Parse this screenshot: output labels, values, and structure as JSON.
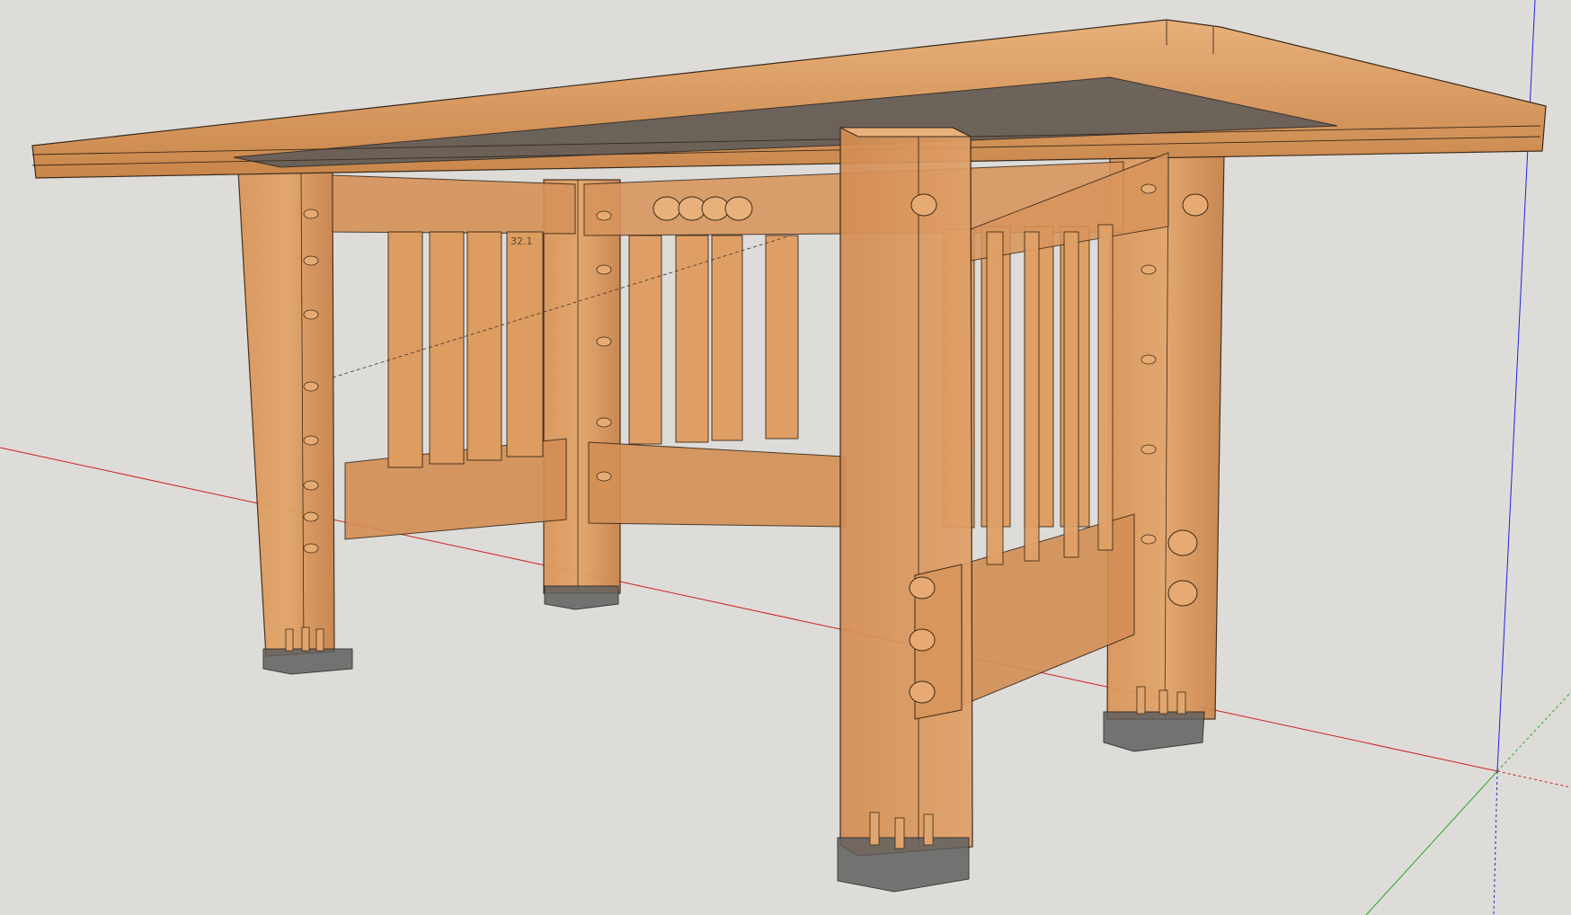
{
  "viewport": {
    "dimension_label": "32.1"
  },
  "colors": {
    "background": "#dedcd8",
    "wood": "#d08a4c",
    "wood_light": "#e2a36a",
    "wood_dark": "#9a5a28",
    "edge": "#3a2a1a",
    "glass": "#5a5a5a",
    "axis_red": "#cc2222",
    "axis_green": "#22aa22",
    "axis_blue": "#2222dd"
  }
}
